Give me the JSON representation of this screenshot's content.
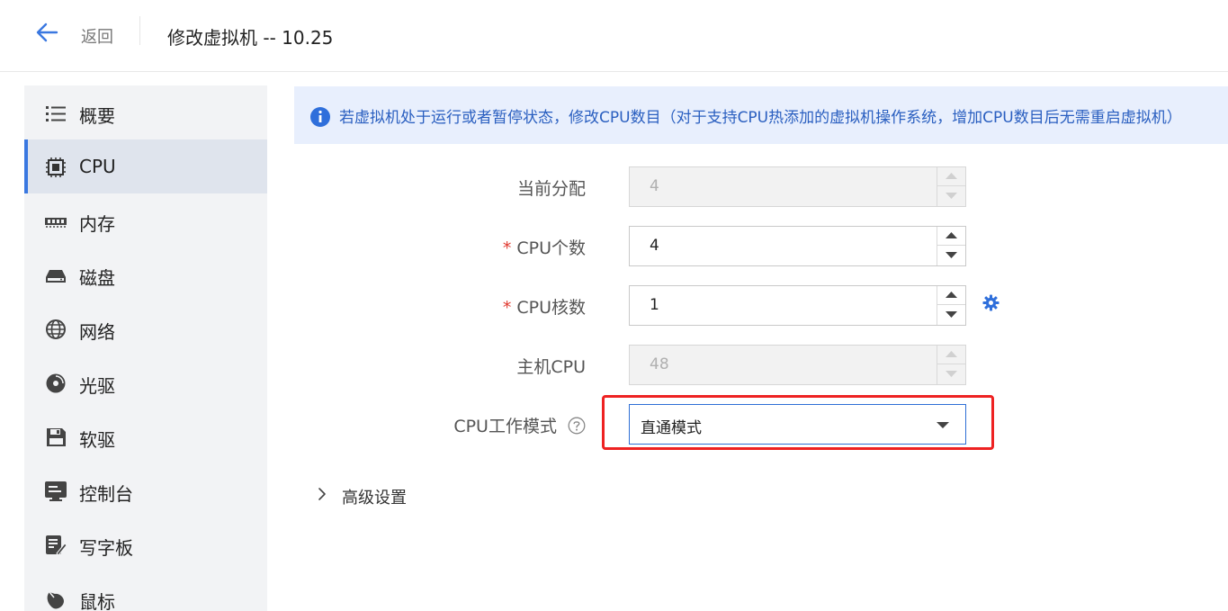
{
  "header": {
    "back_label": "返回",
    "title": "修改虚拟机 -- 10.25"
  },
  "sidebar": {
    "items": [
      {
        "label": "概要",
        "icon": "list-icon",
        "active": false
      },
      {
        "label": "CPU",
        "icon": "cpu-chip-icon",
        "active": true
      },
      {
        "label": "内存",
        "icon": "memory-icon",
        "active": false
      },
      {
        "label": "磁盘",
        "icon": "disk-icon",
        "active": false
      },
      {
        "label": "网络",
        "icon": "globe-icon",
        "active": false
      },
      {
        "label": "光驱",
        "icon": "cd-icon",
        "active": false
      },
      {
        "label": "软驱",
        "icon": "floppy-icon",
        "active": false
      },
      {
        "label": "控制台",
        "icon": "console-icon",
        "active": false
      },
      {
        "label": "写字板",
        "icon": "notepad-icon",
        "active": false
      },
      {
        "label": "鼠标",
        "icon": "mouse-icon",
        "active": false
      }
    ]
  },
  "banner": {
    "text": "若虚拟机处于运行或者暂停状态，修改CPU数目（对于支持CPU热添加的虚拟机操作系统，增加CPU数目后无需重启虚拟机）"
  },
  "form": {
    "current_alloc": {
      "label": "当前分配",
      "value": "4",
      "disabled": true
    },
    "cpu_count": {
      "label": "CPU个数",
      "value": "4",
      "required": true
    },
    "cpu_cores": {
      "label": "CPU核数",
      "value": "1",
      "required": true
    },
    "host_cpu": {
      "label": "主机CPU",
      "value": "48",
      "disabled": true
    },
    "cpu_mode": {
      "label": "CPU工作模式",
      "value": "直通模式"
    }
  },
  "advanced": {
    "label": "高级设置"
  },
  "colors": {
    "accent": "#3a78e0",
    "banner_bg": "#e8effd",
    "banner_text": "#2a5fc0",
    "required": "#e0392f",
    "highlight": "#ee2222"
  }
}
